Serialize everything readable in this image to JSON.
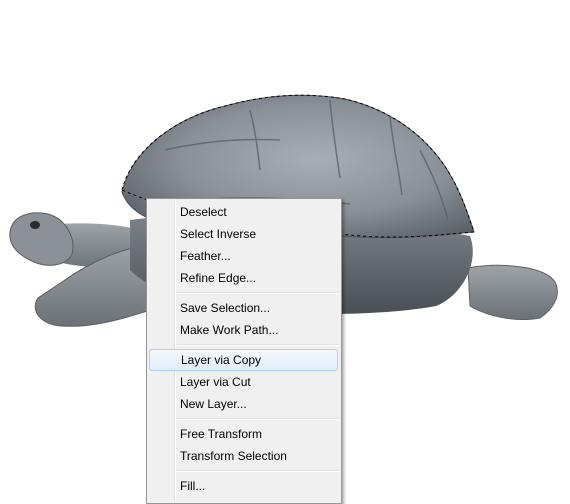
{
  "context_menu": {
    "groups": [
      [
        "Deselect",
        "Select Inverse",
        "Feather...",
        "Refine Edge..."
      ],
      [
        "Save Selection...",
        "Make Work Path..."
      ],
      [
        "Layer via Copy",
        "Layer via Cut",
        "New Layer..."
      ],
      [
        "Free Transform",
        "Transform Selection"
      ],
      [
        "Fill..."
      ]
    ],
    "highlighted": "Layer via Copy"
  }
}
